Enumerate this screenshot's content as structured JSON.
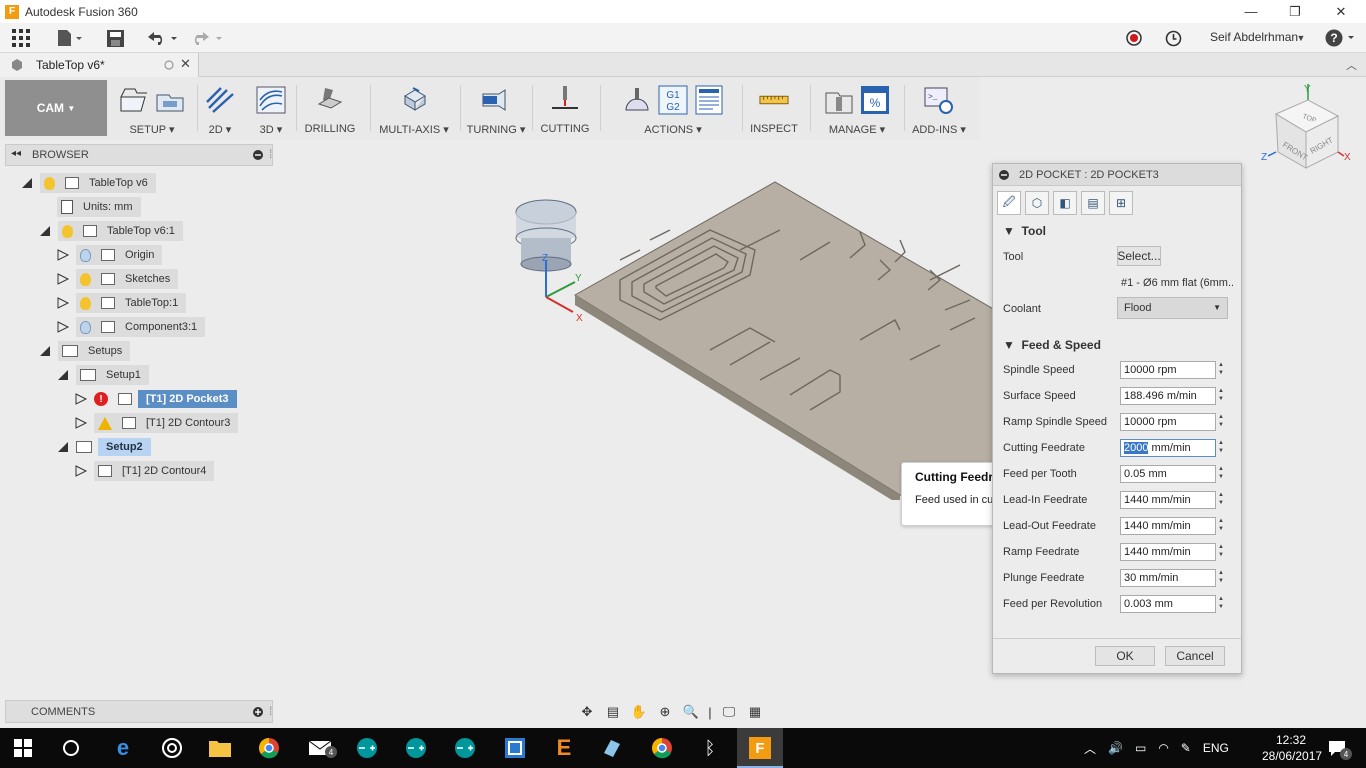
{
  "window": {
    "app_title": "Autodesk Fusion 360",
    "minimize": "—",
    "restore": "❐",
    "close": "✕"
  },
  "qat": {
    "user_name": "Seif Abdelrhman",
    "help": "?"
  },
  "document_tab": {
    "title": "TableTop v6*"
  },
  "toolbar": {
    "workspace": "CAM",
    "groups": [
      {
        "label": "SETUP"
      },
      {
        "label": "2D"
      },
      {
        "label": "3D"
      },
      {
        "label": "DRILLING"
      },
      {
        "label": "MULTI-AXIS"
      },
      {
        "label": "TURNING"
      },
      {
        "label": "CUTTING"
      },
      {
        "label": "ACTIONS"
      },
      {
        "label": "INSPECT"
      },
      {
        "label": "MANAGE"
      },
      {
        "label": "ADD-INS"
      }
    ]
  },
  "browser": {
    "title": "BROWSER",
    "items": [
      {
        "label": "TableTop v6"
      },
      {
        "label": "Units: mm"
      },
      {
        "label": "TableTop v6:1"
      },
      {
        "label": "Origin"
      },
      {
        "label": "Sketches"
      },
      {
        "label": "TableTop:1"
      },
      {
        "label": "Component3:1"
      },
      {
        "label": "Setups"
      },
      {
        "label": "Setup1"
      },
      {
        "label": "[T1] 2D Pocket3"
      },
      {
        "label": "[T1] 2D Contour3"
      },
      {
        "label": "Setup2"
      },
      {
        "label": "[T1] 2D Contour4"
      }
    ]
  },
  "comments": {
    "title": "COMMENTS"
  },
  "tooltip": {
    "title": "Cutting Feedr",
    "description": "Feed used in cut"
  },
  "dialog": {
    "title": "2D POCKET : 2D POCKET3",
    "tool_section": "Tool",
    "tool_label": "Tool",
    "tool_button": "Select...",
    "tool_desc": "#1 - Ø6 mm flat (6mm...",
    "coolant_label": "Coolant",
    "coolant_value": "Flood",
    "feed_section": "Feed & Speed",
    "rows": [
      {
        "label": "Spindle Speed",
        "value": "10000 rpm"
      },
      {
        "label": "Surface Speed",
        "value": "188.496 m/min"
      },
      {
        "label": "Ramp Spindle Speed",
        "value": "10000 rpm"
      },
      {
        "label": "Cutting Feedrate",
        "value_selected": "2000",
        "value_rest": " mm/min"
      },
      {
        "label": "Feed per Tooth",
        "value": "0.05 mm"
      },
      {
        "label": "Lead-In Feedrate",
        "value": "1440 mm/min"
      },
      {
        "label": "Lead-Out Feedrate",
        "value": "1440 mm/min"
      },
      {
        "label": "Ramp Feedrate",
        "value": "1440 mm/min"
      },
      {
        "label": "Plunge Feedrate",
        "value": "30 mm/min"
      },
      {
        "label": "Feed per Revolution",
        "value": "0.003 mm"
      }
    ],
    "ok": "OK",
    "cancel": "Cancel"
  },
  "viewcube": {
    "top": "TOP",
    "front": "FRONT",
    "right": "RIGHT",
    "z": "Z",
    "x": "X",
    "y": "Y"
  },
  "triad": {
    "x": "X",
    "y": "Y",
    "z": "Z"
  },
  "taskbar": {
    "language": "ENG",
    "time": "12:32",
    "date": "28/06/2017",
    "mail_badge": "4",
    "notif_badge": "4"
  },
  "colors": {
    "selection": "#5b8ec5",
    "part": "#b7afa3",
    "error": "#e02020",
    "warning": "#f0b400"
  }
}
